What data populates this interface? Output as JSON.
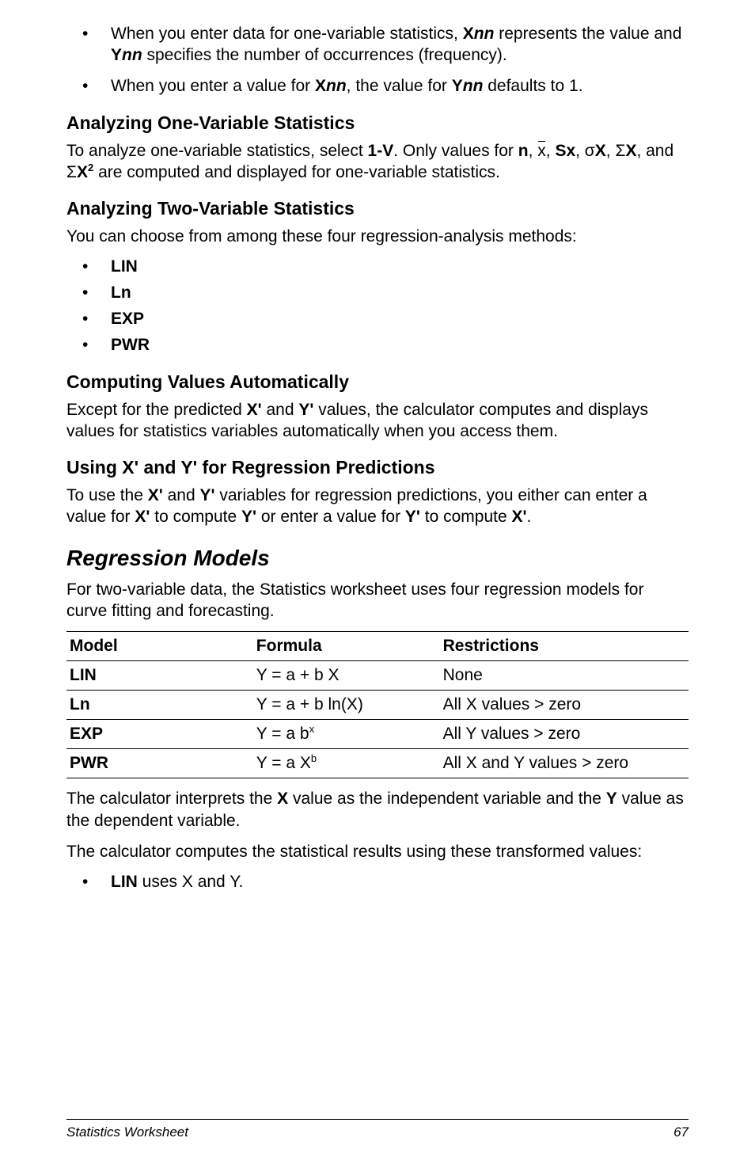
{
  "intro_bullets": [
    {
      "pre": "When you enter data for one-variable statistics, ",
      "b1": "X",
      "i1": "nn",
      "mid": " represents the value and ",
      "b2": "Y",
      "i2": "nn",
      "post": " specifies the number of occurrences (frequency)."
    },
    {
      "pre": "When you enter a value for ",
      "b1": "X",
      "i1": "nn",
      "mid": ", the value for ",
      "b2": "Y",
      "i2": "nn",
      "post": " defaults to 1."
    }
  ],
  "sec1": {
    "title": "Analyzing One-Variable Statistics",
    "p_pre": "To analyze one-variable statistics, select ",
    "p_1v": "1-V",
    "p_mid1": ". Only values for ",
    "p_n": "n",
    "p_c1": ", ",
    "p_xbar": "x",
    "p_c2": ", ",
    "p_sx": "Sx",
    "p_c3": ", ",
    "p_sigma": "σ",
    "p_x1": "X",
    "p_c4": ", ",
    "p_Sigma": "Σ",
    "p_x2": "X",
    "p_and": ", and ",
    "p_Sigma2": "Σ",
    "p_x3": "X",
    "p_sup2": "2",
    "p_post": " are computed and displayed for one-variable statistics."
  },
  "sec2": {
    "title": "Analyzing Two-Variable Statistics",
    "p": "You can choose from among these four regression-analysis methods:",
    "items": [
      "LIN",
      "Ln",
      "EXP",
      "PWR"
    ]
  },
  "sec3": {
    "title": "Computing Values Automatically",
    "p_pre": "Except for the predicted ",
    "p_x": "X'",
    "p_and": " and ",
    "p_y": "Y'",
    "p_post": " values, the calculator computes and displays values for statistics variables automatically when you access them."
  },
  "sec4": {
    "title": "Using X' and Y' for Regression Predictions",
    "p_pre": "To use the ",
    "p_x1": "X'",
    "p_and1": " and ",
    "p_y1": "Y'",
    "p_mid": " variables for regression predictions, you either can enter a value for ",
    "p_x2": "X'",
    "p_mid2": " to compute ",
    "p_y2": "Y'",
    "p_mid3": " or enter a value for ",
    "p_y3": "Y'",
    "p_mid4": " to compute ",
    "p_x3": "X'",
    "p_end": "."
  },
  "regression": {
    "title": "Regression Models",
    "intro": "For two-variable data, the Statistics worksheet uses four regression models for curve fitting and forecasting.",
    "headers": {
      "model": "Model",
      "formula": "Formula",
      "restr": "Restrictions"
    },
    "rows": [
      {
        "model": "LIN",
        "formula_plain": "Y = a + b X",
        "restr": "None"
      },
      {
        "model": "Ln",
        "formula_plain": "Y = a + b ln(X)",
        "restr": "All X values > zero"
      },
      {
        "model": "EXP",
        "formula_base": "Y = a b",
        "formula_exp": "x",
        "restr": "All Y values > zero"
      },
      {
        "model": "PWR",
        "formula_base": "Y = a X",
        "formula_exp": "b",
        "restr": "All X and Y values > zero"
      }
    ],
    "after1_pre": "The calculator interprets the ",
    "after1_x": "X",
    "after1_mid": " value as the independent variable and the ",
    "after1_y": "Y",
    "after1_post": " value as the dependent variable.",
    "after2": "The calculator computes the statistical results using these transformed values:",
    "after3_b": "LIN",
    "after3_rest": " uses X and Y."
  },
  "footer": {
    "left": "Statistics Worksheet",
    "right": "67"
  }
}
